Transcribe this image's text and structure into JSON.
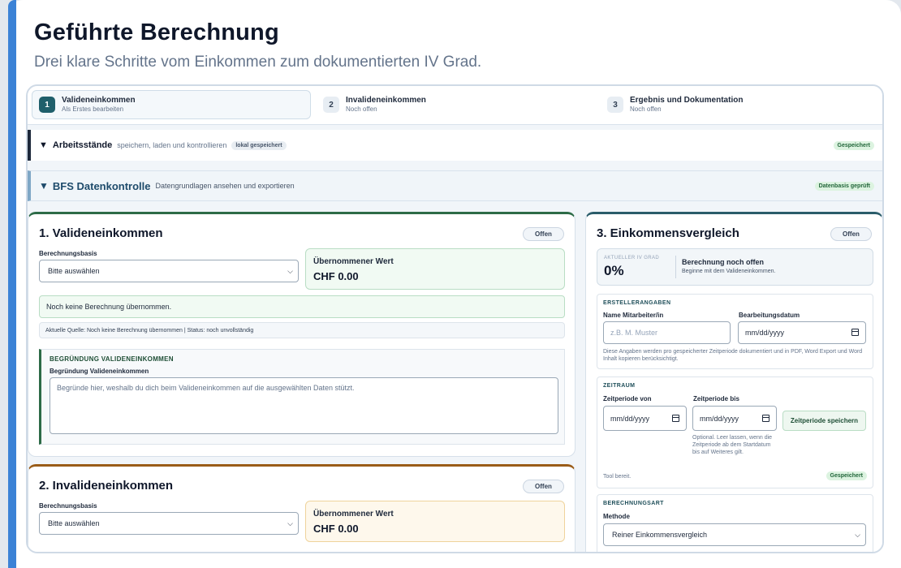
{
  "header": {
    "title": "Geführte Berechnung",
    "subtitle": "Drei klare Schritte vom Einkommen zum dokumentierten IV Grad."
  },
  "steps": [
    {
      "num": "1",
      "title": "Valideneinkommen",
      "sub": "Als Erstes bearbeiten"
    },
    {
      "num": "2",
      "title": "Invalideneinkommen",
      "sub": "Noch offen"
    },
    {
      "num": "3",
      "title": "Ergebnis und Dokumentation",
      "sub": "Noch offen"
    }
  ],
  "arbeitsstaende": {
    "toggle": "▼",
    "title": "Arbeitsstände",
    "hint": "speichern, laden und kontrollieren",
    "badge": "lokal gespeichert",
    "status": "Gespeichert"
  },
  "bfs": {
    "toggle": "▼",
    "title": "BFS Datenkontrolle",
    "hint": "Datengrundlagen ansehen und exportieren",
    "status": "Datenbasis geprüft"
  },
  "valid": {
    "title": "1. Valideneinkommen",
    "status": "Offen",
    "basis_label": "Berechnungsbasis",
    "basis_value": "Bitte auswählen",
    "value_label": "Übernommener Wert",
    "value": "CHF 0.00",
    "note": "Noch keine Berechnung übernommen.",
    "source": "Aktuelle Quelle: Noch keine Berechnung übernommen | Status: noch unvollständig",
    "reason_heading": "BEGRÜNDUNG VALIDENEINKOMMEN",
    "reason_label": "Begründung Valideneinkommen",
    "reason_placeholder": "Begründe hier, weshalb du dich beim Valideneinkommen auf die ausgewählten Daten stützt."
  },
  "invalid": {
    "title": "2. Invalideneinkommen",
    "status": "Offen",
    "basis_label": "Berechnungsbasis",
    "basis_value": "Bitte auswählen",
    "value_label": "Übernommener Wert",
    "value": "CHF 0.00"
  },
  "vergleich": {
    "title": "3. Einkommensvergleich",
    "status": "Offen",
    "iv_key": "AKTUELLER IV GRAD",
    "iv_value": "0%",
    "iv_status": "Berechnung noch offen",
    "iv_desc": "Beginne mit dem Valideneinkommen.",
    "ersteller": {
      "heading": "ERSTELLERANGABEN",
      "name_label": "Name Mitarbeiter/in",
      "name_placeholder": "z.B. M. Muster",
      "date_label": "Bearbeitungsdatum",
      "date_value": "mm/dd/yyyy",
      "note": "Diese Angaben werden pro gespeicherter Zeitperiode dokumentiert und in PDF, Word Export und Word Inhalt kopieren berücksichtigt."
    },
    "zeitraum": {
      "heading": "ZEITRAUM",
      "from_label": "Zeitperiode von",
      "from_value": "mm/dd/yyyy",
      "to_label": "Zeitperiode bis",
      "to_value": "mm/dd/yyyy",
      "save_button": "Zeitperiode speichern",
      "hint": "Optional. Leer lassen, wenn die Zeitperiode ab dem Startdatum bis auf Weiteres gilt.",
      "tool_status": "Tool bereit.",
      "saved": "Gespeichert"
    },
    "berechnungsart": {
      "heading": "BERECHNUNGSART",
      "method_label": "Methode",
      "method_value": "Reiner Einkommensvergleich"
    }
  }
}
